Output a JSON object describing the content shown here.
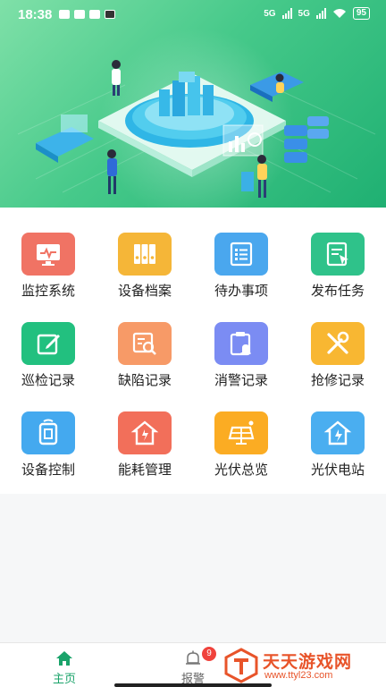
{
  "status_bar": {
    "time": "18:38",
    "network_1": "5G",
    "network_2": "5G",
    "battery": "95"
  },
  "menu": {
    "items": [
      {
        "label": "监控系统",
        "icon": "monitor-icon",
        "color": "#f07364"
      },
      {
        "label": "设备档案",
        "icon": "archive-binders-icon",
        "color": "#f5b638"
      },
      {
        "label": "待办事项",
        "icon": "todo-list-icon",
        "color": "#4aa7ee"
      },
      {
        "label": "发布任务",
        "icon": "publish-task-icon",
        "color": "#2fc28a"
      },
      {
        "label": "巡检记录",
        "icon": "inspection-edit-icon",
        "color": "#22c07f"
      },
      {
        "label": "缺陷记录",
        "icon": "defect-search-icon",
        "color": "#f79a67"
      },
      {
        "label": "消警记录",
        "icon": "alarm-clipboard-icon",
        "color": "#7b8cf3"
      },
      {
        "label": "抢修记录",
        "icon": "repair-tools-icon",
        "color": "#f8b732"
      },
      {
        "label": "设备控制",
        "icon": "device-control-icon",
        "color": "#44a9ef"
      },
      {
        "label": "能耗管理",
        "icon": "energy-house-icon",
        "color": "#f26f5a"
      },
      {
        "label": "光伏总览",
        "icon": "solar-panel-icon",
        "color": "#fbac23"
      },
      {
        "label": "光伏电站",
        "icon": "solar-station-icon",
        "color": "#4aaef0"
      }
    ]
  },
  "bottom_nav": {
    "home_label": "主页",
    "alarm_label": "报警",
    "alarm_badge": "9",
    "active_color": "#1aa36a"
  },
  "watermark": {
    "title": "天天游戏网",
    "url": "www.ttyl23.com"
  }
}
